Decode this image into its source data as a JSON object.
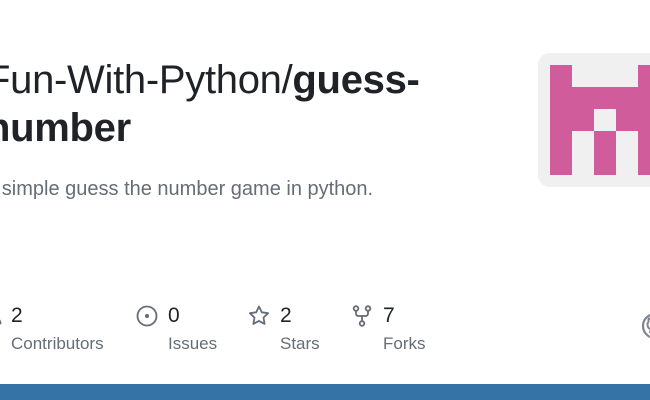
{
  "repo": {
    "owner": "Fun-With-Python/",
    "name_line1": "guess-",
    "name_line2": "number",
    "description": "A simple guess the number game in python."
  },
  "stats": [
    {
      "count": "2",
      "label": "Contributors",
      "icon": "people-icon"
    },
    {
      "count": "0",
      "label": "Issues",
      "icon": "issue-opened-icon"
    },
    {
      "count": "2",
      "label": "Stars",
      "icon": "star-icon"
    },
    {
      "count": "7",
      "label": "Forks",
      "icon": "repo-forked-icon"
    }
  ],
  "avatar": {
    "icon": "identicon-avatar",
    "color": "#d15c9b",
    "background": "#f0f0f0"
  },
  "language_bar": {
    "color": "#3572a5"
  },
  "github_mark": {
    "icon": "github-mark-icon"
  }
}
